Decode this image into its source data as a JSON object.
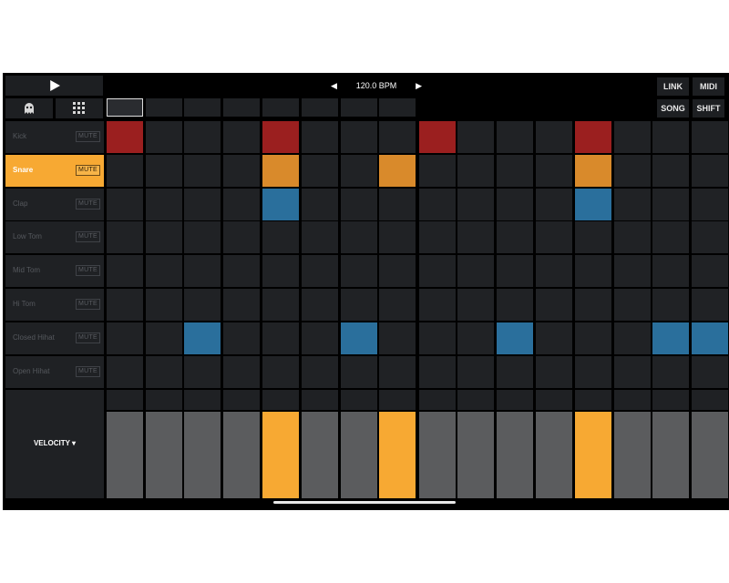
{
  "transport": {
    "play_icon": "play-icon",
    "tempo_label": "120.0 BPM",
    "prev_icon": "tempo-down-icon",
    "next_icon": "tempo-up-icon"
  },
  "toolbar": {
    "link_label": "LINK",
    "midi_label": "MIDI",
    "song_label": "SONG",
    "shift_label": "SHIFT",
    "ghost_icon": "ghost-icon",
    "grid_icon": "grid-icon"
  },
  "colors": {
    "kick": "#9b1f1f",
    "snare": "#d98a2b",
    "clap": "#2a6f9c",
    "hihat": "#2a6f9c",
    "accent": "#f7a933",
    "velocity_bar": "#5b5c5e"
  },
  "tracks": [
    {
      "name": "Kick",
      "mute_label": "MUTE",
      "selected": false,
      "steps": [
        0,
        4,
        8,
        12
      ],
      "color": "#9b1f1f"
    },
    {
      "name": "Snare",
      "mute_label": "MUTE",
      "selected": true,
      "steps": [
        4,
        7,
        12
      ],
      "color": "#d98a2b"
    },
    {
      "name": "Clap",
      "mute_label": "MUTE",
      "selected": false,
      "steps": [
        4,
        12
      ],
      "color": "#2a6f9c"
    },
    {
      "name": "Low Tom",
      "mute_label": "MUTE",
      "selected": false,
      "steps": [],
      "color": "#2a6f9c"
    },
    {
      "name": "Mid Tom",
      "mute_label": "MUTE",
      "selected": false,
      "steps": [],
      "color": "#2a6f9c"
    },
    {
      "name": "Hi Tom",
      "mute_label": "MUTE",
      "selected": false,
      "steps": [],
      "color": "#2a6f9c"
    },
    {
      "name": "Closed Hihat",
      "mute_label": "MUTE",
      "selected": false,
      "steps": [
        2,
        6,
        10,
        14,
        15
      ],
      "color": "#2a6f9c"
    },
    {
      "name": "Open Hihat",
      "mute_label": "MUTE",
      "selected": false,
      "steps": [],
      "color": "#2a6f9c"
    }
  ],
  "velocity": {
    "label": "VELOCITY ▾",
    "active_steps": [
      4,
      7,
      12
    ],
    "level": 1.0
  },
  "pages": {
    "count": 8,
    "selected": 0
  }
}
